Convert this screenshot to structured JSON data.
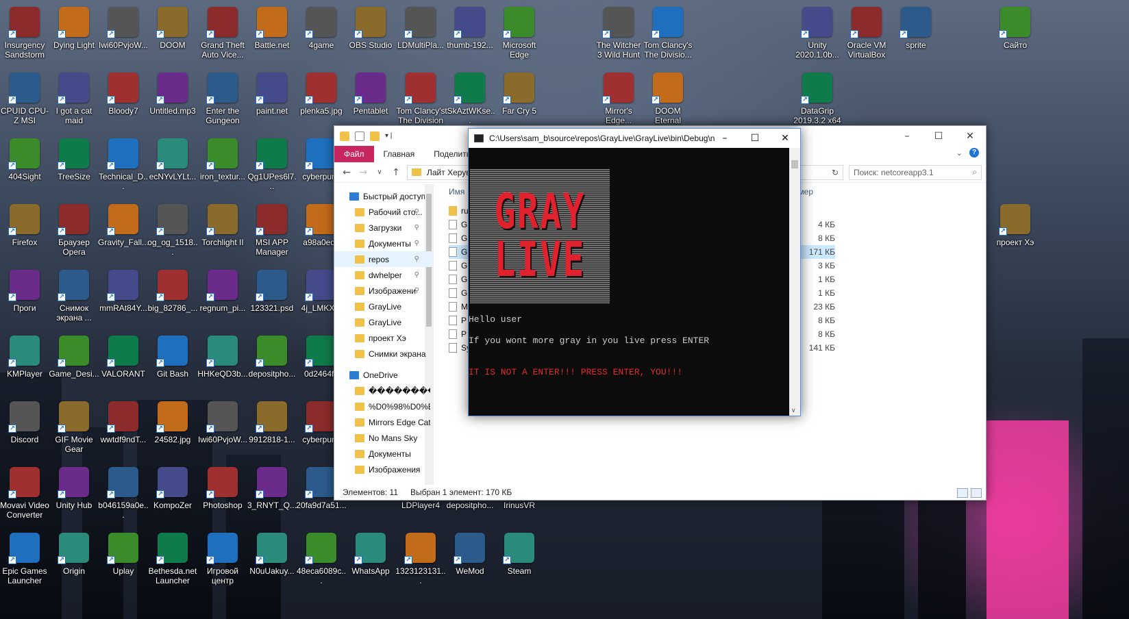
{
  "desktop_icons": {
    "col1": [
      "Insurgency Sandstorm",
      "CPUID CPU-Z MSI",
      "404Sight",
      "Firefox",
      "Проги",
      "KMPlayer",
      "Discord",
      "Movavi Video Converter",
      "Epic Games Launcher"
    ],
    "col2": [
      "Dying Light",
      "I got a cat maid",
      "TreeSize",
      "Браузер Opera",
      "Снимок экрана ...",
      "Game_Desi...",
      "GIF Movie Gear",
      "Unity Hub",
      "Origin"
    ],
    "col3": [
      "Iwi60PvjoW...",
      "Bloody7",
      "Technical_D...",
      "Gravity_Fall...",
      "mmRAt84Y...",
      "VALORANT",
      "wwtdf9ndT...",
      "b046159a0e...",
      "Uplay"
    ],
    "col4": [
      "DOOM",
      "Untitled.mp3",
      "ecNYvLYLt...",
      "og_og_1518...",
      "big_82786_...",
      "Git Bash",
      "24582.jpg",
      "KompoZer",
      "Bethesda.net Launcher"
    ],
    "col5": [
      "Grand Theft Auto Vice...",
      "Enter the Gungeon",
      "iron_textur...",
      "Torchlight II",
      "regnum_pi...",
      "HHKeQD3b...",
      "Iwi60PvjoW...",
      "Photoshop",
      "Игровой центр"
    ],
    "col6": [
      "Battle.net",
      "paint.net",
      "Qg1UPes6l7...",
      "MSI APP Manager",
      "123321.psd",
      "depositpho...",
      "9912818-1...",
      "3_RNYT_Q...",
      "N0uUakuy..."
    ],
    "col7": [
      "4game",
      "plenka5.jpg",
      "cyberpunk",
      "a98a0ed9",
      "4j_LMKXm",
      "0d2464f3",
      "cyberpunk",
      "20fa9d7a51...",
      "48eca6089c..."
    ],
    "col8": [
      "OBS Studio",
      "Pentablet",
      "WhatsApp"
    ],
    "col9": [
      "LDMultiPla...",
      "Tom Clancy's The Division",
      "LDPlayer4",
      "1323123131..."
    ],
    "col10": [
      "thumb-192...",
      "tSkAztWKse...",
      "depositpho...",
      "WeMod"
    ],
    "col11": [
      "Microsoft Edge",
      "Far Cry 5",
      "IrinusVR",
      "Steam"
    ],
    "col12": [
      "The Witcher 3 Wild Hunt",
      "Mirror's Edge..."
    ],
    "col13": [
      "Tom Clancy's The Divisio...",
      "DOOM Eternal"
    ],
    "col14": [
      "Unity 2020.1.0b...",
      "DataGrip 2019.3.2 x64"
    ],
    "col15": [
      "Oracle VM VirtualBox"
    ],
    "col16": [
      "sprite"
    ],
    "col17": [
      "Сайто",
      "проект Хэ"
    ]
  },
  "explorer": {
    "tabs": [
      "Файл",
      "Главная",
      "Поделиться"
    ],
    "address": "Лайт Херув",
    "search_placeholder": "Поиск: netcoreapp3.1",
    "columns": {
      "name": "Имя",
      "size": "мер"
    },
    "nav_items": [
      {
        "label": "Быстрый доступ",
        "top": true
      },
      {
        "label": "Рабочий сто...",
        "pin": true
      },
      {
        "label": "Загрузки",
        "pin": true
      },
      {
        "label": "Документы",
        "pin": true
      },
      {
        "label": "repos",
        "pin": true,
        "selected": true
      },
      {
        "label": "dwhelper",
        "pin": true
      },
      {
        "label": "Изображени",
        "pin": true
      },
      {
        "label": "GrayLive"
      },
      {
        "label": "GrayLive"
      },
      {
        "label": "проект Хэ"
      },
      {
        "label": "Снимки экрана"
      },
      {
        "label": "OneDrive",
        "top": true
      },
      {
        "label": "��������"
      },
      {
        "label": "%D0%98%D0%B"
      },
      {
        "label": "Mirrors Edge Cat"
      },
      {
        "label": "No Mans Sky"
      },
      {
        "label": "Документы"
      },
      {
        "label": "Изображения"
      }
    ],
    "files": [
      {
        "name": "ru",
        "size": ""
      },
      {
        "name": "G",
        "size": "4 КБ"
      },
      {
        "name": "G",
        "size": "8 КБ"
      },
      {
        "name": "G",
        "size": "171 КБ",
        "selected": true
      },
      {
        "name": "G",
        "size": "3 КБ"
      },
      {
        "name": "G",
        "size": "1 КБ"
      },
      {
        "name": "G",
        "size": "1 КБ"
      },
      {
        "name": "M",
        "size": "23 КБ"
      },
      {
        "name": "P",
        "size": "8 КБ"
      },
      {
        "name": "P",
        "size": "8 КБ"
      },
      {
        "name": "Sy",
        "size": "141 КБ"
      }
    ],
    "status_items": "Элементов: 11",
    "status_selected": "Выбран 1 элемент: 170 КБ"
  },
  "console": {
    "title": "C:\\Users\\sam_b\\source\\repos\\GrayLive\\GrayLive\\bin\\Debug\\n...",
    "art_line1": "GRAY",
    "art_line2": "LIVE",
    "line1": "Hello user",
    "line2": "If you wont more gray in you live press ENTER",
    "line3": "IT IS NOT A ENTER!!! PRESS ENTER, YOU!!!"
  }
}
